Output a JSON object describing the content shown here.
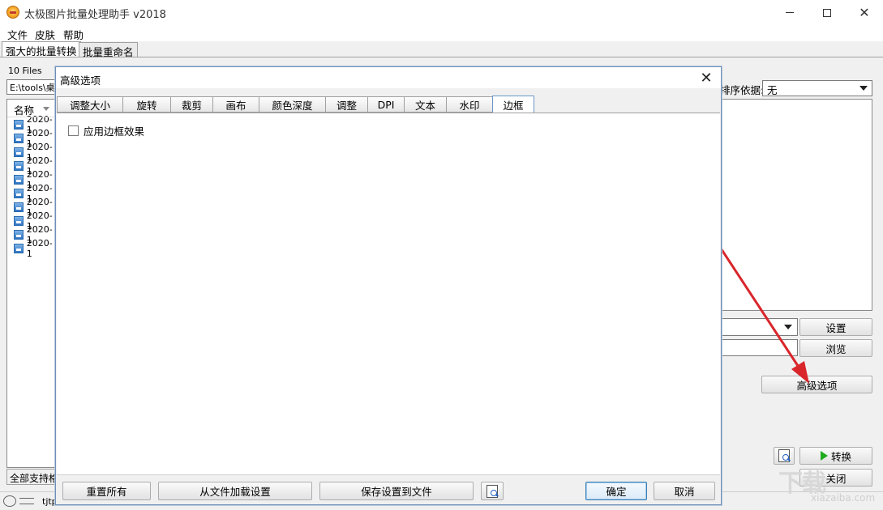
{
  "window": {
    "title": "太极图片批量处理助手  v2018",
    "icon": "app-logo-icon"
  },
  "menu": [
    "文件",
    "皮肤",
    "帮助"
  ],
  "main_tabs": [
    {
      "label": "强大的批量转换",
      "active": true
    },
    {
      "label": "批量重命名",
      "active": false
    }
  ],
  "files": {
    "count_label": "10 Files",
    "path": "E:\\tools\\桌面",
    "column_name": "名称",
    "items": [
      "2020-1",
      "2020-1",
      "2020-1",
      "2020-1",
      "2020-1",
      "2020-1",
      "2020-1",
      "2020-1",
      "2020-1",
      "2020-1"
    ],
    "filter_label": "全部支持格式"
  },
  "sort": {
    "label": "排序依据:",
    "value": "无"
  },
  "buttons": {
    "settings": "设置",
    "browse": "浏览",
    "advanced": "高级选项",
    "convert": "转换",
    "close": "关闭"
  },
  "status": {
    "text": "tjtp"
  },
  "watermark": {
    "main": "下载",
    "sub": "xiazaiba.com"
  },
  "annotation_color": "#d9262b",
  "dialog": {
    "title": "高级选项",
    "tabs": [
      {
        "label": "调整大小",
        "active": false
      },
      {
        "label": "旋转",
        "active": false
      },
      {
        "label": "裁剪",
        "active": false
      },
      {
        "label": "画布",
        "active": false
      },
      {
        "label": "颜色深度",
        "active": false
      },
      {
        "label": "调整",
        "active": false
      },
      {
        "label": "DPI",
        "active": false
      },
      {
        "label": "文本",
        "active": false
      },
      {
        "label": "水印",
        "active": false
      },
      {
        "label": "边框",
        "active": true
      }
    ],
    "checkbox_label": "应用边框效果",
    "checkbox_checked": false,
    "buttons": {
      "reset": "重置所有",
      "load": "从文件加载设置",
      "save": "保存设置到文件",
      "ok": "确定",
      "cancel": "取消"
    }
  }
}
